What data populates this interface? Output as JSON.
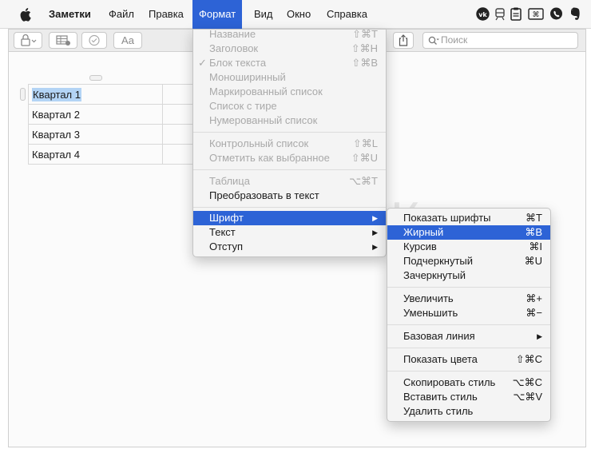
{
  "menubar": {
    "items": [
      "Заметки",
      "Файл",
      "Правка",
      "Формат",
      "Вид",
      "Окно",
      "Справка"
    ],
    "active": "Формат"
  },
  "toolbar": {
    "font_button": "Aa",
    "search_placeholder": "Поиск"
  },
  "table": {
    "rows": [
      "Квартал 1",
      "Квартал 2",
      "Квартал 3",
      "Квартал 4"
    ]
  },
  "format_menu": {
    "items": [
      {
        "label": "Название",
        "shortcut": "⇧⌘T"
      },
      {
        "label": "Заголовок",
        "shortcut": "⇧⌘H"
      },
      {
        "label": "Блок текста",
        "shortcut": "⇧⌘B"
      },
      {
        "label": "Моноширинный",
        "shortcut": ""
      },
      {
        "label": "Маркированный список",
        "shortcut": ""
      },
      {
        "label": "Список с тире",
        "shortcut": ""
      },
      {
        "label": "Нумерованный список",
        "shortcut": ""
      },
      {
        "label": "Контрольный список",
        "shortcut": "⇧⌘L"
      },
      {
        "label": "Отметить как выбранное",
        "shortcut": "⇧⌘U"
      },
      {
        "label": "Таблица",
        "shortcut": "⌥⌘T"
      },
      {
        "label": "Преобразовать в текст",
        "shortcut": ""
      },
      {
        "label": "Шрифт",
        "shortcut": ""
      },
      {
        "label": "Текст",
        "shortcut": ""
      },
      {
        "label": "Отступ",
        "shortcut": ""
      }
    ]
  },
  "font_menu": {
    "items": [
      {
        "label": "Показать шрифты",
        "shortcut": "⌘T"
      },
      {
        "label": "Жирный",
        "shortcut": "⌘B"
      },
      {
        "label": "Курсив",
        "shortcut": "⌘I"
      },
      {
        "label": "Подчеркнутый",
        "shortcut": "⌘U"
      },
      {
        "label": "Зачеркнутый",
        "shortcut": ""
      },
      {
        "label": "Увеличить",
        "shortcut": "⌘+"
      },
      {
        "label": "Уменьшить",
        "shortcut": "⌘−"
      },
      {
        "label": "Базовая линия",
        "shortcut": ""
      },
      {
        "label": "Показать цвета",
        "shortcut": "⇧⌘C"
      },
      {
        "label": "Скопировать стиль",
        "shortcut": "⌥⌘C"
      },
      {
        "label": "Вставить стиль",
        "shortcut": "⌥⌘V"
      },
      {
        "label": "Удалить стиль",
        "shortcut": ""
      }
    ]
  },
  "watermark": "ЯБЛЫК",
  "colors": {
    "highlight": "#2d63d6",
    "selection": "#b3d4f5"
  }
}
